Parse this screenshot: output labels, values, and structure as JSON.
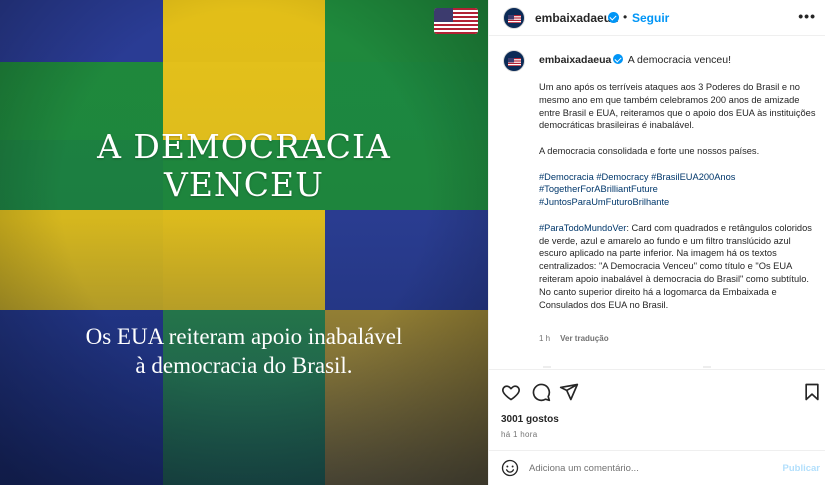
{
  "post_image": {
    "title_lines": [
      "A DEMOCRACIA",
      "VENCEU"
    ],
    "subtitle_lines": [
      "Os EUA reiteram apoio inabalável",
      "à democracia do Brasil."
    ],
    "colors": {
      "green": "#1f8a3c",
      "yellow": "#e6c21a",
      "blue": "#263a8f",
      "overlay": "#0f1e55"
    },
    "logo_icon": "us-flag-icon"
  },
  "header": {
    "username": "embaixadaeua",
    "separator": "•",
    "follow_label": "Seguir",
    "more_icon": "•••"
  },
  "caption": {
    "username": "embaixadaeua",
    "headline": "A democracia venceu!",
    "paragraph1": "Um ano após os terríveis ataques aos 3 Poderes do Brasil e no mesmo ano em que também celebramos 200 anos de amizade entre Brasil e EUA, reiteramos que o apoio dos EUA às instituições democráticas brasileiras é inabalável.",
    "paragraph2": "A democracia consolidada e forte une nossos países.",
    "hashtags": [
      "#Democracia",
      "#Democracy",
      "#BrasilEUA200Anos",
      "#TogetherForABrilliantFuture",
      "#JuntosParaUmFuturoBrilhante"
    ],
    "alt_tag": "#ParaTodoMundoVer",
    "alt_text": ": Card com quadrados e retângulos coloridos de verde, azul e amarelo ao fundo e um filtro translúcido azul escuro aplicado na parte inferior. Na imagem há os textos centralizados: \"A Democracia Venceu\" como título e \"Os EUA reiteram apoio inabalável à democracia do Brasil\" como subtítulo. No canto superior direito há a logomarca da Embaixada e Consulados dos EUA no Brasil.",
    "time": "1 h",
    "translate_label": "Ver tradução"
  },
  "stats": {
    "likes": "3001 gostos",
    "posted": "há 1 hora"
  },
  "comment": {
    "placeholder": "Adiciona um comentário...",
    "publish_label": "Publicar"
  }
}
